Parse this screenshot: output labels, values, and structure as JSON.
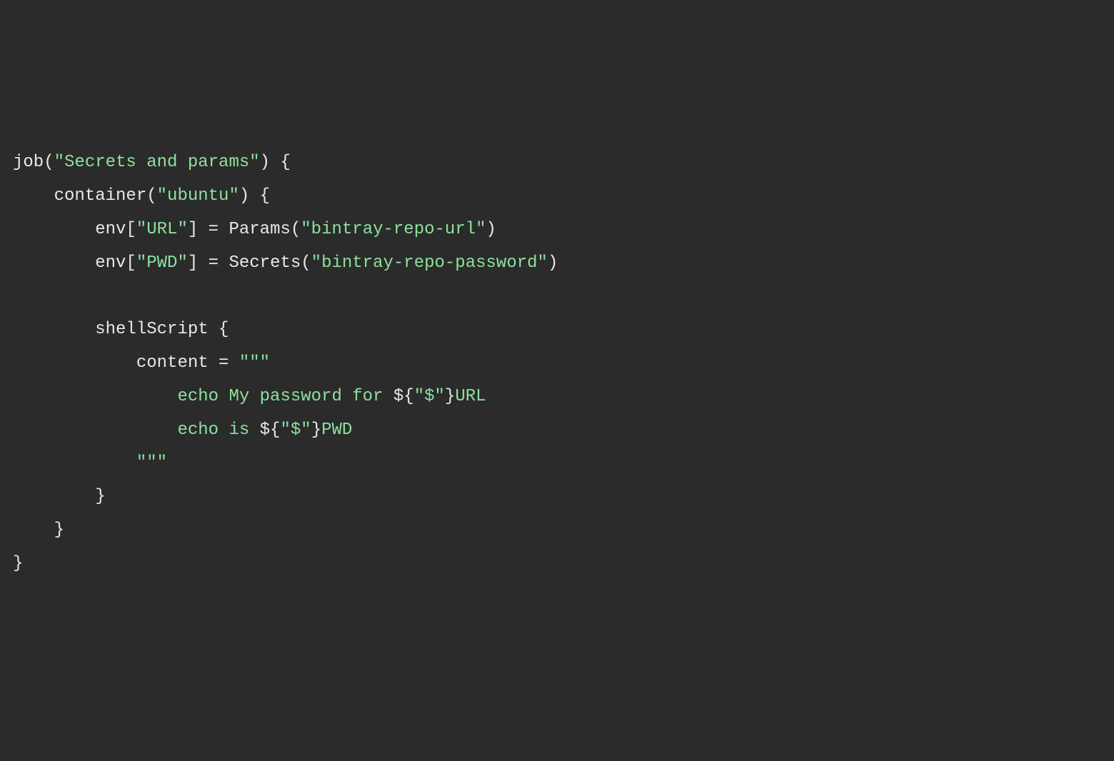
{
  "code": {
    "line1": {
      "t1": "job(",
      "t2": "\"Secrets and params\"",
      "t3": ") {"
    },
    "line2": {
      "t1": "    container(",
      "t2": "\"ubuntu\"",
      "t3": ") {"
    },
    "line3": {
      "t1": "        env[",
      "t2": "\"URL\"",
      "t3": "] = Params(",
      "t4": "\"bintray-repo-url\"",
      "t5": ")"
    },
    "line4": {
      "t1": "        env[",
      "t2": "\"PWD\"",
      "t3": "] = Secrets(",
      "t4": "\"bintray-repo-password\"",
      "t5": ")"
    },
    "line5": {
      "t1": " "
    },
    "line6": {
      "t1": "        shellScript {"
    },
    "line7": {
      "t1": "            content = ",
      "t2": "\"\"\""
    },
    "line8": {
      "t1": "                echo My password for ",
      "t2": "${",
      "t3": "\"$\"",
      "t4": "}",
      "t5": "URL"
    },
    "line9": {
      "t1": "                echo is ",
      "t2": "${",
      "t3": "\"$\"",
      "t4": "}",
      "t5": "PWD"
    },
    "line10": {
      "t1": "            \"\"\""
    },
    "line11": {
      "t1": "        }"
    },
    "line12": {
      "t1": "    }"
    },
    "line13": {
      "t1": "}"
    }
  }
}
